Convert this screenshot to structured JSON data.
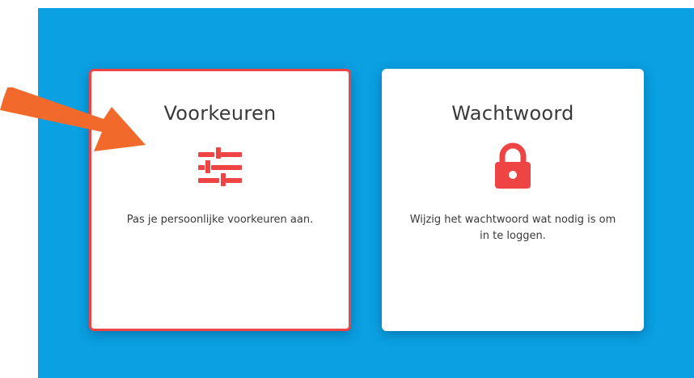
{
  "colors": {
    "background_panel": "#0aa0e2",
    "card_background": "#ffffff",
    "accent_red": "#ef4444",
    "arrow_orange": "#f26a2b",
    "text": "#3a3a3a"
  },
  "cards": [
    {
      "title": "Voorkeuren",
      "icon": "sliders-icon",
      "description": "Pas je persoonlijke voorkeuren aan.",
      "selected": true
    },
    {
      "title": "Wachtwoord",
      "icon": "lock-icon",
      "description": "Wijzig het wachtwoord wat nodig is om in te loggen.",
      "selected": false
    }
  ],
  "annotation": {
    "icon": "arrow-icon",
    "points_to": "Voorkeuren"
  }
}
